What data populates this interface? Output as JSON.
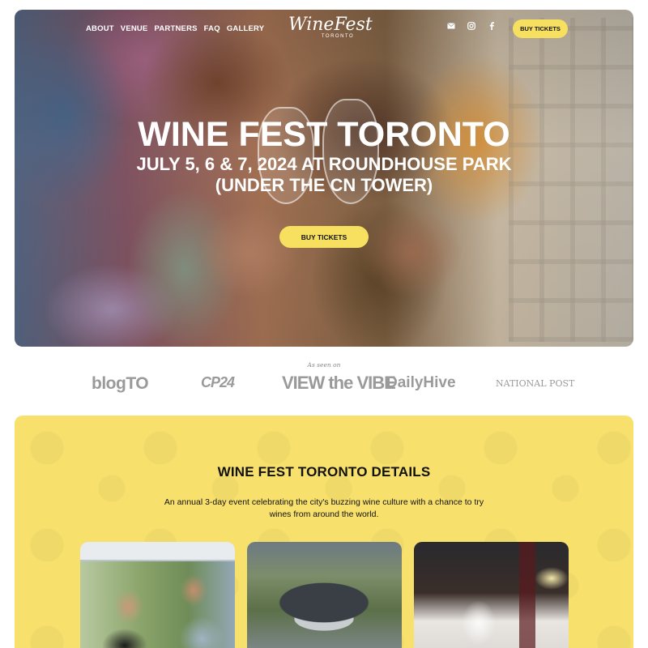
{
  "nav": {
    "items": [
      {
        "label": "ABOUT"
      },
      {
        "label": "VENUE"
      },
      {
        "label": "PARTNERS"
      },
      {
        "label": "FAQ"
      },
      {
        "label": "GALLERY"
      }
    ]
  },
  "logo": {
    "main": "WineFest",
    "sub": "TORONTO"
  },
  "social": {
    "icons": [
      "mail-icon",
      "instagram-icon",
      "facebook-icon"
    ]
  },
  "header": {
    "buy_label": "BUY TICKETS"
  },
  "hero": {
    "title": "WINE FEST TORONTO",
    "date_line": "JULY 5, 6 & 7, 2024 AT ROUNDHOUSE PARK",
    "sub_line": "(UNDER THE CN TOWER)",
    "buy_label": "BUY TICKETS"
  },
  "press": {
    "heading": "As seen on",
    "logos": [
      "blogTO",
      "CP24",
      "VIEW the VIBE",
      "DailyHive",
      "NATIONAL POST"
    ]
  },
  "details": {
    "title": "WINE FEST TORONTO DETAILS",
    "description": "An annual 3-day event celebrating the city's buzzing wine culture with a chance to try wines from around the world."
  },
  "colors": {
    "accent": "#f7e060",
    "section_bg": "#f7e06c"
  }
}
